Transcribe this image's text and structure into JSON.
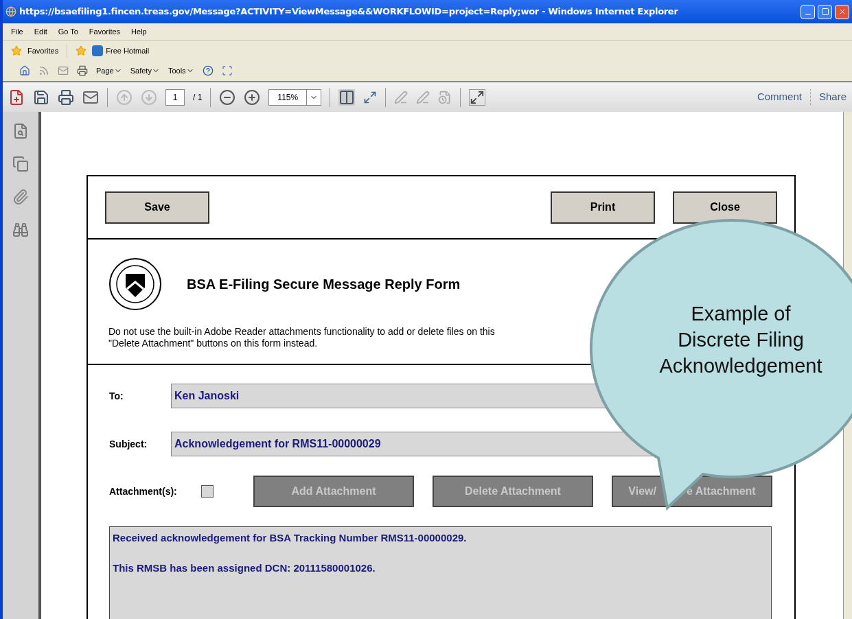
{
  "window": {
    "title": "https://bsaefiling1.fincen.treas.gov/Message?ACTIVITY=ViewMessage&&WORKFLOWID=project=Reply;wor - Windows Internet Explorer"
  },
  "menu": [
    "File",
    "Edit",
    "Go To",
    "Favorites",
    "Help"
  ],
  "favorites_bar": {
    "favorites": "Favorites",
    "links": [
      "Free Hotmail"
    ]
  },
  "command_bar": [
    "Page",
    "Safety",
    "Tools"
  ],
  "pdf_toolbar": {
    "page": "1",
    "page_count": "/ 1",
    "zoom": "115%",
    "comment": "Comment",
    "share": "Share"
  },
  "form": {
    "left_buttons": [
      "Save"
    ],
    "right_buttons": [
      "Print",
      "Close"
    ],
    "title": "BSA E-Filing Secure Message Reply Form",
    "notice": [
      "Do not use the built-in Adobe Reader attachments functionality to add or delete files on this",
      "\"Delete Attachment\" buttons on this form instead."
    ],
    "fields": [
      {
        "label": "To:",
        "value": "Ken Janoski"
      },
      {
        "label": "Subject:",
        "value": "Acknowledgement for RMS11-00000029"
      }
    ],
    "attachments": {
      "label": "Attachment(s):",
      "checked": false,
      "buttons": [
        {
          "parts": [
            "Add Attachment"
          ],
          "disabled": true
        },
        {
          "parts": [
            "Delete Attachment"
          ],
          "disabled": true
        },
        {
          "parts": [
            "View/",
            "e Attachment"
          ],
          "disabled": true
        }
      ]
    },
    "message": [
      "Received acknowledgement for BSA Tracking Number RMS11-00000029.",
      "This RMSB has been assigned DCN: 20111580001026."
    ]
  },
  "callout": {
    "lines": [
      "Example of",
      "Discrete Filing",
      "Acknowledgement"
    ]
  }
}
